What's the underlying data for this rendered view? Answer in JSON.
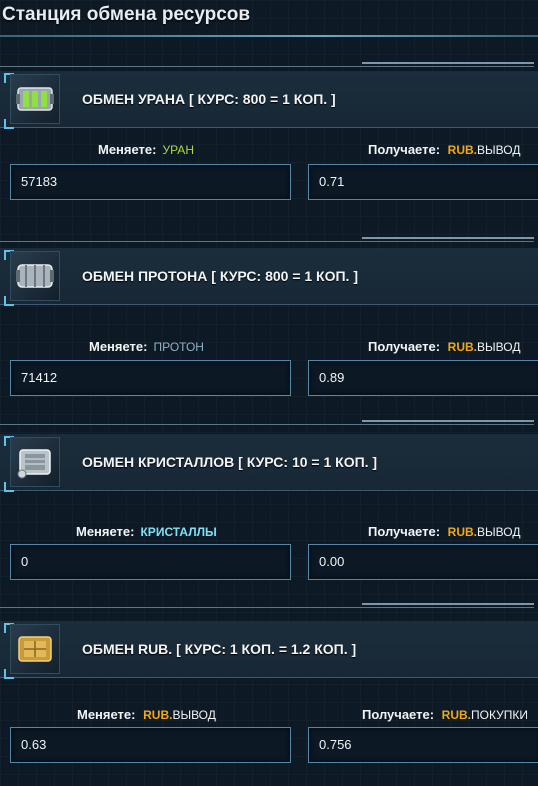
{
  "page_title": "Станция обмена ресурсов",
  "common": {
    "give_label": "Меняете:",
    "get_label": "Получаете:"
  },
  "sections": [
    {
      "title": "ОБМЕН УРАНА [ КУРС: 800 = 1 КОП. ]",
      "give_resource": "УРАН",
      "give_color": "#a8d84a",
      "give_value": "57183",
      "get_currency": "RUB.",
      "get_suffix": "ВЫВОД",
      "get_value": "0.71",
      "icon": "uranium-container-icon"
    },
    {
      "title": "ОБМЕН ПРОТОНА [ КУРС: 800 = 1 КОП. ]",
      "give_resource": "ПРОТОН",
      "give_color": "#8fb1c6",
      "give_value": "71412",
      "get_currency": "RUB.",
      "get_suffix": "ВЫВОД",
      "get_value": "0.89",
      "icon": "proton-container-icon"
    },
    {
      "title": "ОБМЕН КРИСТАЛЛОВ [ КУРС: 10 = 1 КОП. ]",
      "give_resource": "КРИСТАЛЛЫ",
      "give_color": "#7fe0f5",
      "give_value": "0",
      "get_currency": "RUB.",
      "get_suffix": "ВЫВОД",
      "get_value": "0.00",
      "icon": "crystal-container-icon"
    },
    {
      "title": "ОБМЕН RUB. [ КУРС: 1 КОП. = 1.2 КОП. ]",
      "give_currency": "RUB.",
      "give_suffix": "ВЫВОД",
      "give_value": "0.63",
      "get_currency": "RUB.",
      "get_suffix": "ПОКУПКИ",
      "get_value": "0.756",
      "icon": "gold-container-icon"
    }
  ],
  "colors": {
    "accent": "#5fc2e6",
    "rub": "#f2a812",
    "background": "#0d1a26"
  }
}
